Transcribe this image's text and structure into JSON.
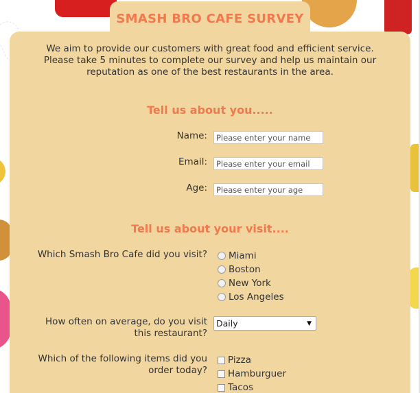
{
  "survey": {
    "title": "SMASH BRO CAFE SURVEY",
    "intro": "We aim to provide our customers with great food and efficient service. Please take 5 minutes to complete our survey and help us maintain our reputation as one of the best restaurants in the area."
  },
  "about_you": {
    "heading": "Tell us about you.....",
    "name_label": "Name:",
    "name_placeholder": "Please enter your name",
    "email_label": "Email:",
    "email_placeholder": "Please enter your email",
    "age_label": "Age:",
    "age_placeholder": "Please enter your age"
  },
  "about_visit": {
    "heading": "Tell us about your visit....",
    "location_question": "Which Smash Bro Cafe did you visit?",
    "locations": [
      "Miami",
      "Boston",
      "New York",
      "Los Angeles"
    ],
    "frequency_question_line1": "How often on average, do you visit",
    "frequency_question_line2": "this restaurant?",
    "frequency_selected": "Daily",
    "items_question_line1": "Which of the following items did you",
    "items_question_line2": "order today?",
    "items": [
      "Pizza",
      "Hamburguer",
      "Tacos"
    ]
  },
  "icons": {
    "dropdown": "chevron-down-icon"
  },
  "colors": {
    "card_bg": "#f2d6a0",
    "accent": "#f0794d"
  }
}
